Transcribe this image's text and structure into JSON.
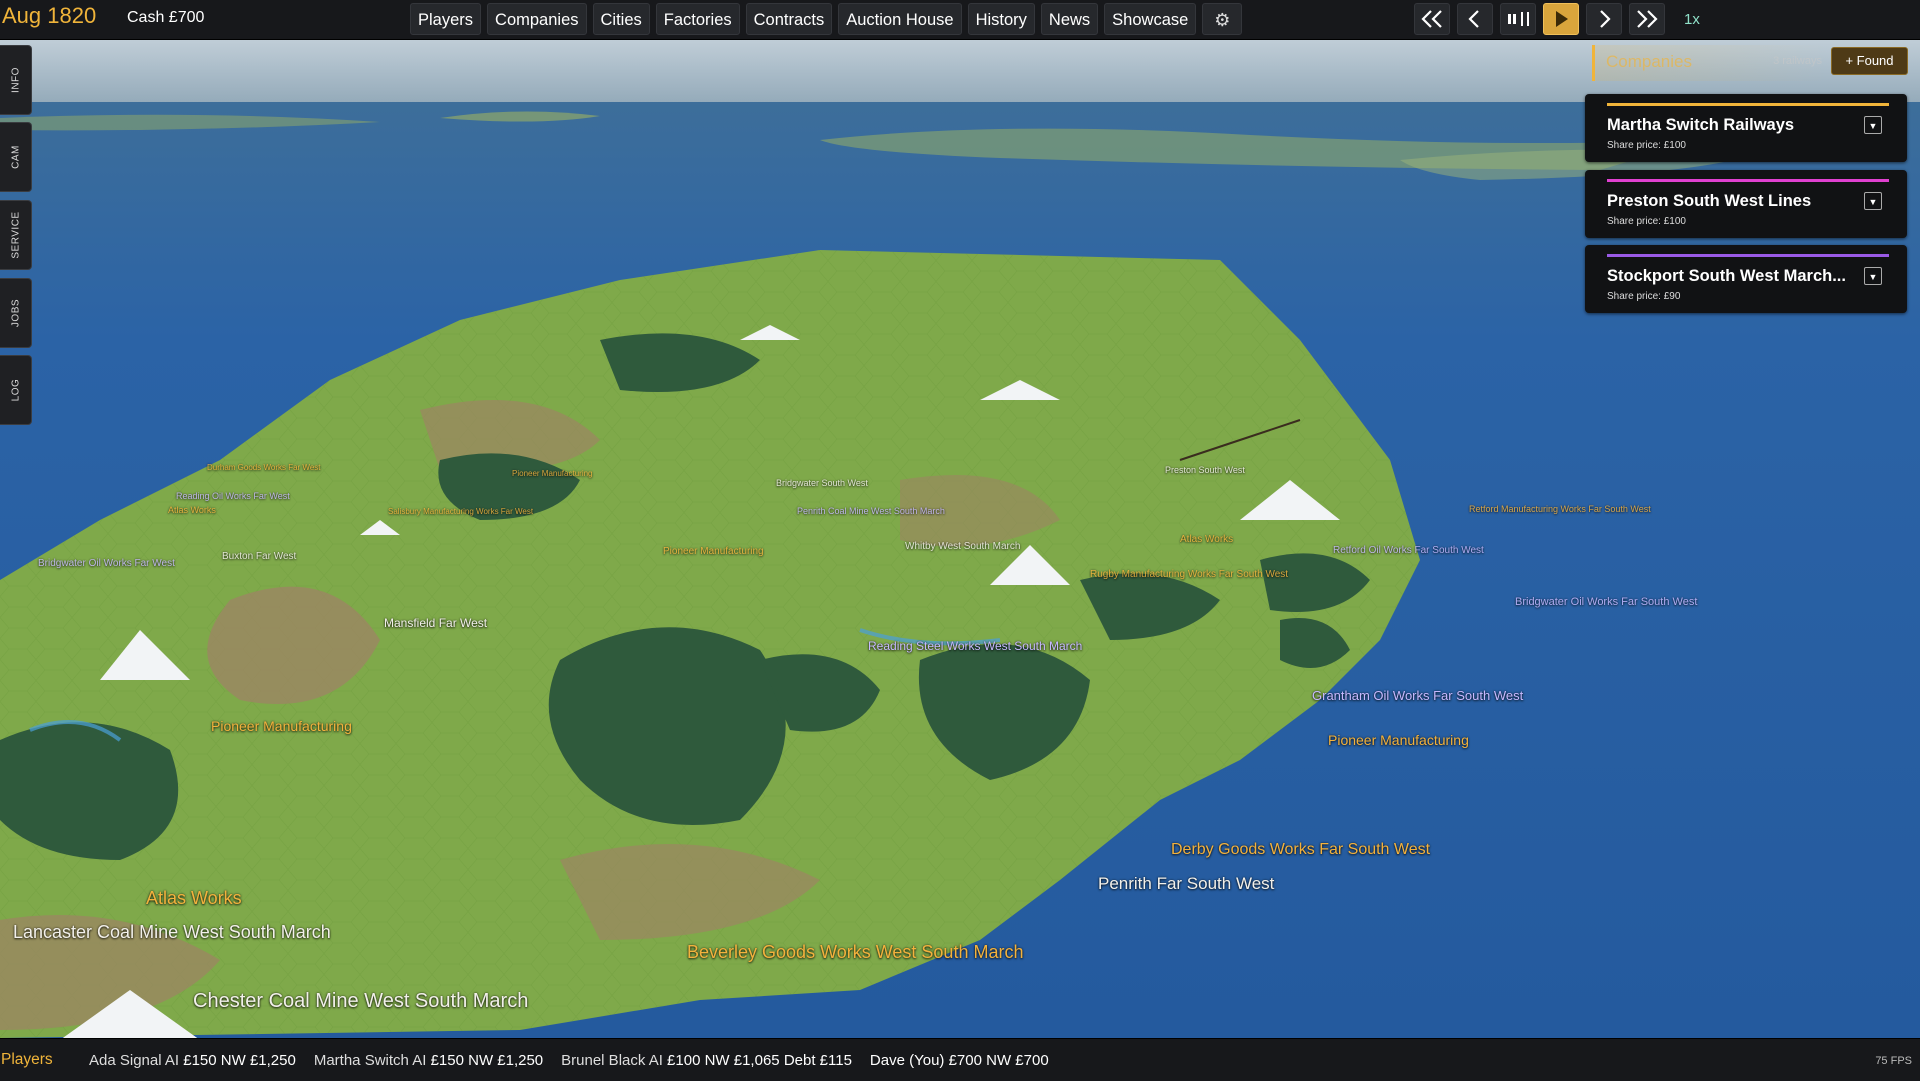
{
  "topbar": {
    "date": "Aug 1820",
    "cash": "Cash £700",
    "menu": [
      "Players",
      "Companies",
      "Cities",
      "Factories",
      "Contracts",
      "Auction House",
      "History",
      "News",
      "Showcase"
    ],
    "settings_icon": "gear-icon",
    "speed_label": "1x"
  },
  "side_tabs": [
    "INFO",
    "CAM",
    "SERVICE",
    "JOBS",
    "LOG"
  ],
  "companies": {
    "title": "Companies",
    "count": "3 railways",
    "found_label": "+ Found",
    "items": [
      {
        "name": "Martha Switch Railways",
        "share": "Share price: £100",
        "color": "#f0b43a"
      },
      {
        "name": "Preston South West Lines",
        "share": "Share price: £100",
        "color": "#e040d0"
      },
      {
        "name": "Stockport South West March...",
        "share": "Share price: £90",
        "color": "#9a5ae6"
      }
    ]
  },
  "map_labels": [
    {
      "text": "Atlas Works",
      "kind": "fac",
      "size": 18
    },
    {
      "text": "Lancaster Coal Mine West South March",
      "kind": "city",
      "size": 18
    },
    {
      "text": "Chester Coal Mine West South March",
      "kind": "city",
      "size": 20
    },
    {
      "text": "Beverley Goods Works West South March",
      "kind": "fac",
      "size": 18
    },
    {
      "text": "Penrith Far South West",
      "kind": "city",
      "size": 17
    },
    {
      "text": "Derby Goods Works Far South West",
      "kind": "fac",
      "size": 16
    },
    {
      "text": "Pioneer Manufacturing",
      "kind": "fac",
      "size": 14
    },
    {
      "text": "Pioneer Manufacturing",
      "kind": "fac",
      "size": 14
    },
    {
      "text": "Grantham Oil Works Far South West",
      "kind": "ind",
      "size": 13
    },
    {
      "text": "Reading Steel Works West South March",
      "kind": "ind",
      "size": 12
    },
    {
      "text": "Mansfield Far West",
      "kind": "city",
      "size": 12
    },
    {
      "text": "Bridgwater Oil Works Far West",
      "kind": "ind",
      "size": 10
    },
    {
      "text": "Buxton Far West",
      "kind": "city",
      "size": 10
    },
    {
      "text": "Reading Oil Works Far West",
      "kind": "ind",
      "size": 9
    },
    {
      "text": "Atlas Works",
      "kind": "fac",
      "size": 9
    },
    {
      "text": "Pioneer Manufacturing",
      "kind": "fac",
      "size": 10
    },
    {
      "text": "Whitby West South March",
      "kind": "city",
      "size": 10
    },
    {
      "text": "Bridgwater South West",
      "kind": "city",
      "size": 9
    },
    {
      "text": "Rugby Manufacturing Works Far South West",
      "kind": "fac",
      "size": 10
    },
    {
      "text": "Atlas Works",
      "kind": "fac",
      "size": 10
    },
    {
      "text": "Retford Oil Works Far South West",
      "kind": "ind",
      "size": 10
    },
    {
      "text": "Bridgwater Oil Works Far South West",
      "kind": "ind",
      "size": 11
    },
    {
      "text": "Preston South West",
      "kind": "city",
      "size": 9
    },
    {
      "text": "Penrith Coal Mine West South March",
      "kind": "ind",
      "size": 9
    },
    {
      "text": "Durham Goods Works Far West",
      "kind": "fac",
      "size": 8
    },
    {
      "text": "Salisbury Manufacturing Works Far West",
      "kind": "fac",
      "size": 8
    },
    {
      "text": "Pioneer Manufacturing",
      "kind": "fac",
      "size": 8
    },
    {
      "text": "Retford Manufacturing Works Far South West",
      "kind": "fac",
      "size": 9
    }
  ],
  "bottombar": {
    "label": "Players",
    "players": [
      {
        "name": "Ada Signal AI",
        "cash": "£150",
        "nw": "NW £1,250",
        "debt": ""
      },
      {
        "name": "Martha Switch AI",
        "cash": "£150",
        "nw": "NW £1,250",
        "debt": ""
      },
      {
        "name": "Brunel Black AI",
        "cash": "£100",
        "nw": "NW £1,065",
        "debt": "Debt £115"
      },
      {
        "name": "Dave (You)",
        "cash": "£700",
        "nw": "NW £700",
        "debt": ""
      }
    ],
    "fps": "75 FPS"
  }
}
